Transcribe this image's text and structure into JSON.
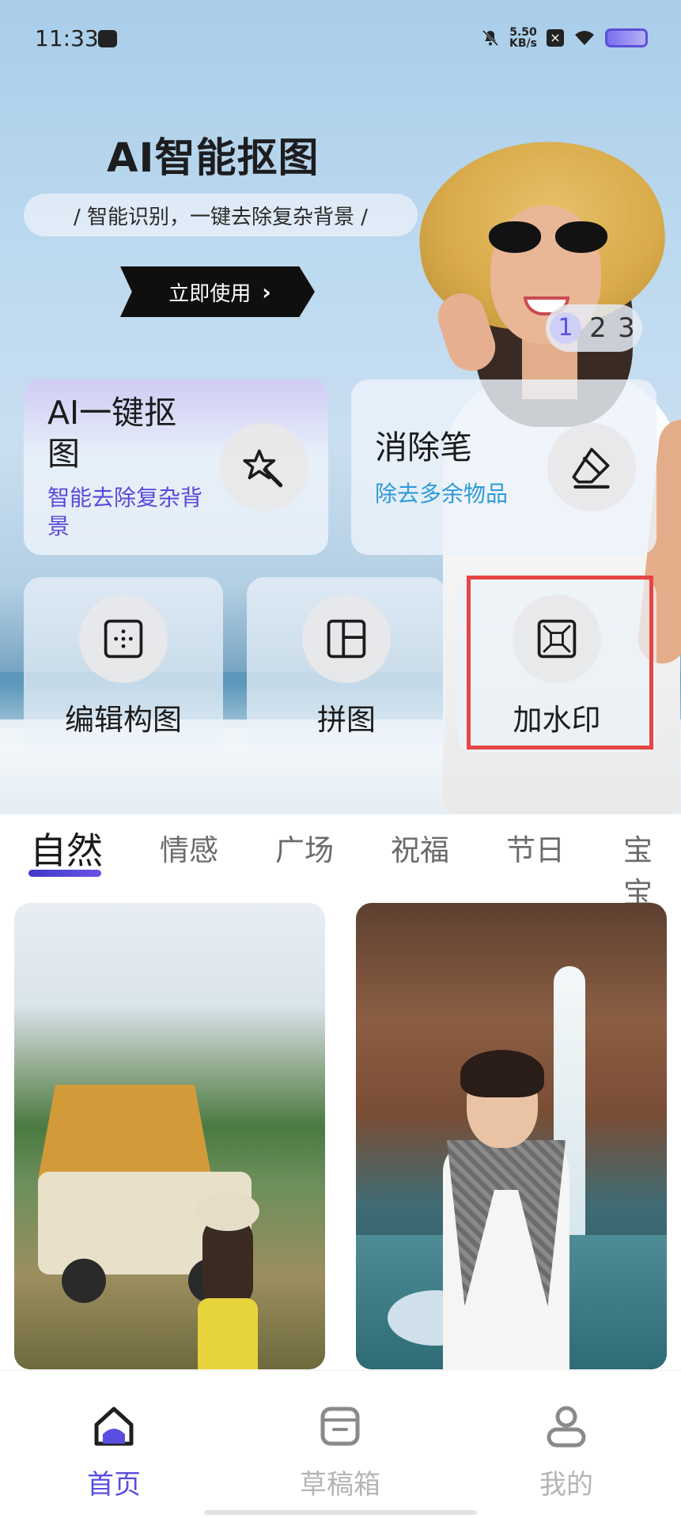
{
  "status_bar": {
    "time": "11:33",
    "net_speed_value": "5.50",
    "net_speed_unit": "KB/s"
  },
  "banner": {
    "title": "AI智能抠图",
    "subtitle": "/ 智能识别，一键去除复杂背景 /",
    "cta_label": "立即使用",
    "pager": [
      "1",
      "2",
      "3"
    ],
    "pager_active": "1"
  },
  "features": {
    "ai_cutout": {
      "title": "AI一键抠图",
      "desc": "智能去除复杂背景",
      "icon": "magic-wand-icon"
    },
    "eraser": {
      "title": "消除笔",
      "desc": "除去多余物品",
      "icon": "eraser-icon"
    },
    "edit_layout": {
      "label": "编辑构图",
      "icon": "grid-icon"
    },
    "collage": {
      "label": "拼图",
      "icon": "collage-icon"
    },
    "watermark": {
      "label": "加水印",
      "icon": "watermark-icon"
    }
  },
  "tabs": [
    "自然",
    "情感",
    "广场",
    "祝福",
    "节日",
    "宝宝"
  ],
  "active_tab": "自然",
  "bottom_nav": {
    "home": "首页",
    "drafts": "草稿箱",
    "mine": "我的"
  },
  "colors": {
    "accent": "#5a4ee0",
    "highlight": "#e64545",
    "desc_purple": "#5b48d8",
    "desc_blue": "#2f9ad8"
  }
}
